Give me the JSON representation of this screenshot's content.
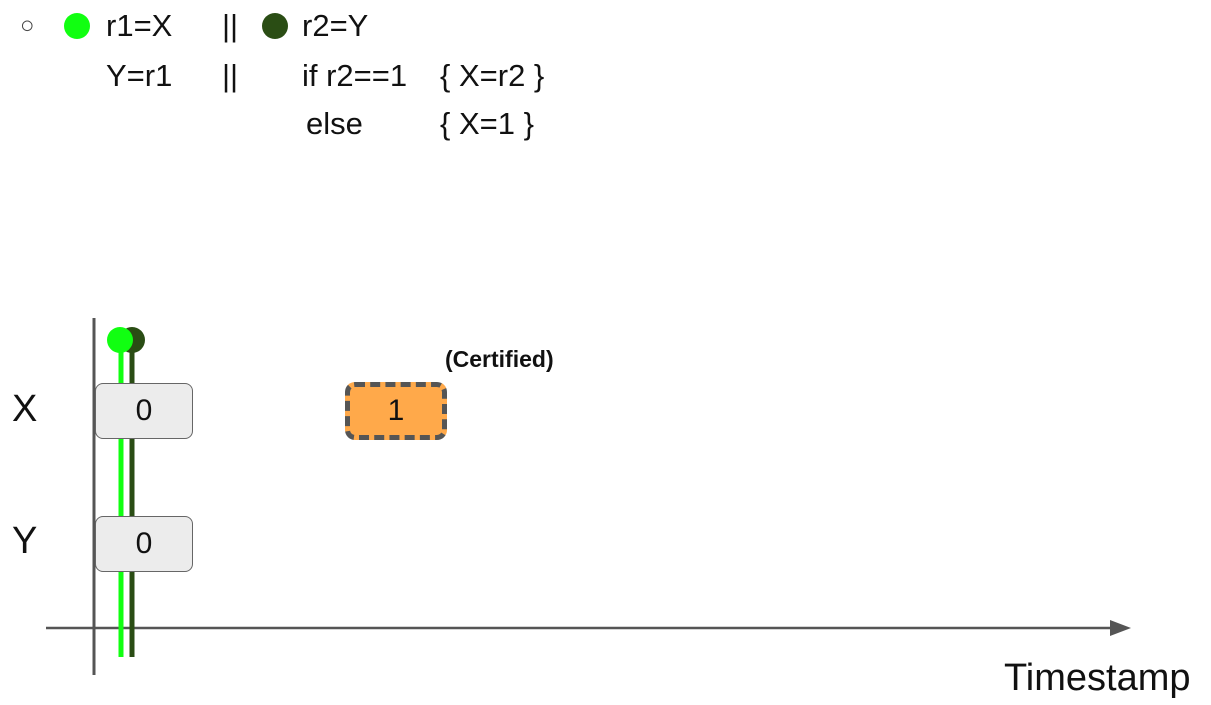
{
  "program": {
    "option_marker": "○",
    "thread1": {
      "color": "#11ff11",
      "lines": [
        "r1=X",
        "Y=r1"
      ]
    },
    "separator": "||",
    "thread2": {
      "color": "#2a4d14",
      "lines": [
        "r2=Y",
        "if r2==1",
        "else"
      ],
      "branches": [
        "{ X=r2 }",
        "{ X=1  }"
      ]
    }
  },
  "timeline": {
    "rows": [
      {
        "label": "X",
        "initial_value": "0"
      },
      {
        "label": "Y",
        "initial_value": "0"
      }
    ],
    "certified_write": {
      "variable": "X",
      "value": "1",
      "annotation": "(Certified)",
      "fill": "#ffa94a"
    },
    "x_axis_label": "Timestamp"
  }
}
